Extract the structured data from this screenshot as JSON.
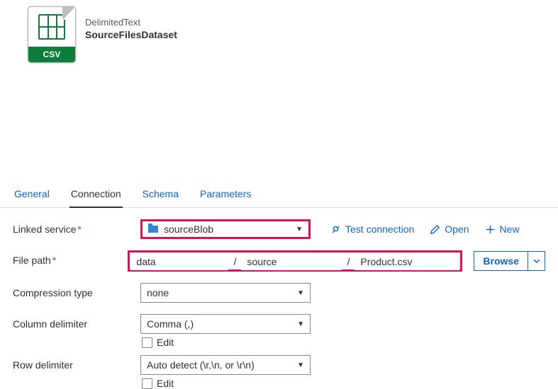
{
  "header": {
    "type_label": "DelimitedText",
    "name": "SourceFilesDataset",
    "tile_text": "CSV"
  },
  "tabs": {
    "items": [
      "General",
      "Connection",
      "Schema",
      "Parameters"
    ],
    "active_index": 1
  },
  "form": {
    "linked_service": {
      "label": "Linked service",
      "required": true,
      "value": "sourceBlob",
      "actions": {
        "test": "Test connection",
        "open": "Open",
        "new": "New"
      }
    },
    "file_path": {
      "label": "File path",
      "required": true,
      "container": "data",
      "directory": "source",
      "file": "Product.csv",
      "sep": "/",
      "browse": "Browse"
    },
    "compression": {
      "label": "Compression type",
      "value": "none"
    },
    "col_delim": {
      "label": "Column delimiter",
      "value": "Comma (,)",
      "edit": "Edit"
    },
    "row_delim": {
      "label": "Row delimiter",
      "value": "Auto detect (\\r,\\n, or \\r\\n)",
      "edit": "Edit"
    }
  }
}
